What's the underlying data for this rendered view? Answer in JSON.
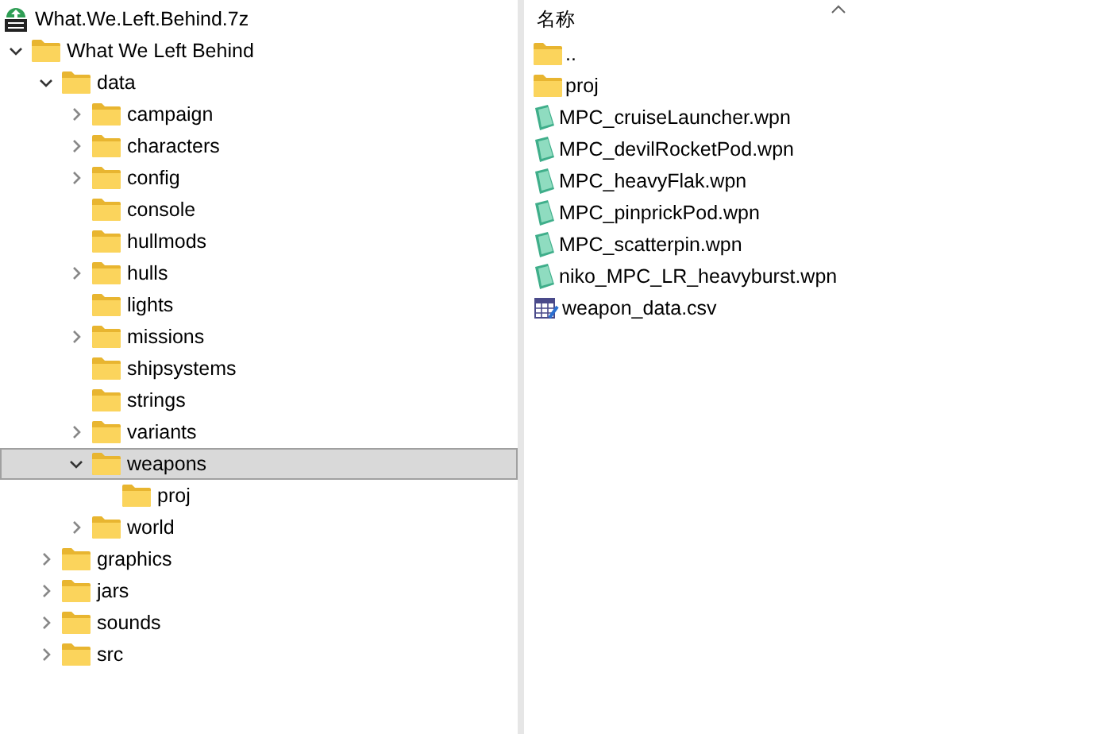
{
  "archive": {
    "name": "What.We.Left.Behind.7z"
  },
  "tree": [
    {
      "label": "What We Left Behind",
      "expanded": true,
      "selected": false,
      "children": [
        {
          "label": "data",
          "expanded": true,
          "selected": false,
          "children": [
            {
              "label": "campaign",
              "expanded": false,
              "selected": false
            },
            {
              "label": "characters",
              "expanded": false,
              "selected": false
            },
            {
              "label": "config",
              "expanded": false,
              "selected": false
            },
            {
              "label": "console",
              "selected": false
            },
            {
              "label": "hullmods",
              "selected": false
            },
            {
              "label": "hulls",
              "expanded": false,
              "selected": false
            },
            {
              "label": "lights",
              "selected": false
            },
            {
              "label": "missions",
              "expanded": false,
              "selected": false
            },
            {
              "label": "shipsystems",
              "selected": false
            },
            {
              "label": "strings",
              "selected": false
            },
            {
              "label": "variants",
              "expanded": false,
              "selected": false
            },
            {
              "label": "weapons",
              "expanded": true,
              "selected": true,
              "children": [
                {
                  "label": "proj",
                  "selected": false
                }
              ]
            },
            {
              "label": "world",
              "expanded": false,
              "selected": false
            }
          ]
        },
        {
          "label": "graphics",
          "expanded": false,
          "selected": false
        },
        {
          "label": "jars",
          "expanded": false,
          "selected": false
        },
        {
          "label": "sounds",
          "expanded": false,
          "selected": false
        },
        {
          "label": "src",
          "expanded": false,
          "selected": false
        }
      ]
    }
  ],
  "file_list": {
    "column": "名称",
    "files": [
      {
        "name": "..",
        "kind": "folder"
      },
      {
        "name": "proj",
        "kind": "folder"
      },
      {
        "name": "MPC_cruiseLauncher.wpn",
        "kind": "wpn"
      },
      {
        "name": "MPC_devilRocketPod.wpn",
        "kind": "wpn"
      },
      {
        "name": "MPC_heavyFlak.wpn",
        "kind": "wpn"
      },
      {
        "name": "MPC_pinprickPod.wpn",
        "kind": "wpn"
      },
      {
        "name": "MPC_scatterpin.wpn",
        "kind": "wpn"
      },
      {
        "name": "niko_MPC_LR_heavyburst.wpn",
        "kind": "wpn"
      },
      {
        "name": "weapon_data.csv",
        "kind": "csv"
      }
    ]
  }
}
